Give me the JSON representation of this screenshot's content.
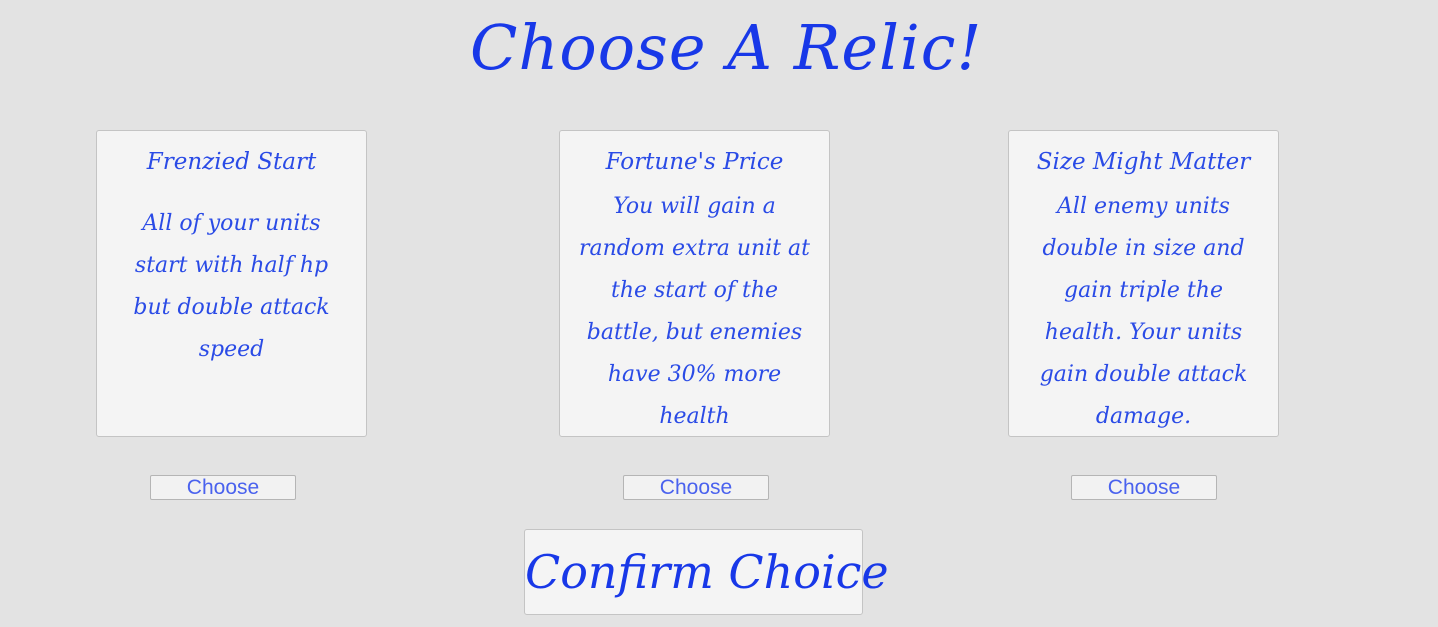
{
  "title": "Choose A Relic!",
  "relics": [
    {
      "name": "Frenzied Start",
      "description": "All of your units start with half hp but double attack speed",
      "button_label": "Choose"
    },
    {
      "name": "Fortune's Price",
      "description": "You will gain a random extra unit at the start of the battle, but enemies have 30% more health",
      "button_label": "Choose"
    },
    {
      "name": "Size Might Matter",
      "description": "All enemy units double in size and gain triple the health. Your units gain double attack damage.",
      "button_label": "Choose"
    }
  ],
  "confirm_label": "Confirm Choice",
  "colors": {
    "background": "#e3e3e3",
    "panel": "#f4f4f4",
    "text": "#2a4be6",
    "title": "#1838e8"
  }
}
